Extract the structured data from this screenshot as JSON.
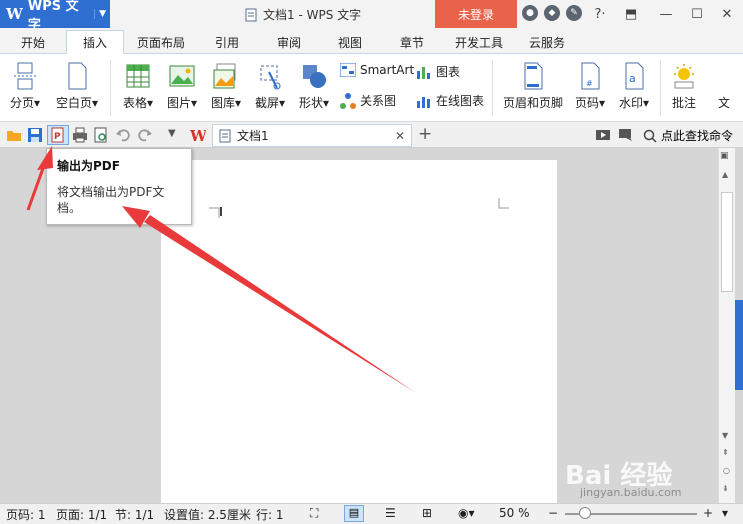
{
  "app": {
    "brand": "WPS 文字",
    "doc_title": "文档1 - WPS 文字",
    "login": "未登录"
  },
  "tabs": [
    "开始",
    "插入",
    "页面布局",
    "引用",
    "审阅",
    "视图",
    "章节",
    "开发工具",
    "云服务"
  ],
  "active_tab": "插入",
  "ribbon": {
    "page_break": "分页",
    "blank_page": "空白页",
    "table": "表格",
    "picture": "图片",
    "gallery": "图库",
    "screenshot": "截屏",
    "shape": "形状",
    "smartart": "SmartArt",
    "relation": "关系图",
    "chart": "图表",
    "online_chart": "在线图表",
    "header_footer": "页眉和页脚",
    "page_number": "页码",
    "watermark": "水印",
    "comment": "批注",
    "text": "文"
  },
  "doc_tab": {
    "name": "文档1"
  },
  "search_cmd": "点此查找命令",
  "tooltip": {
    "title": "输出为PDF",
    "desc": "将文档输出为PDF文档。"
  },
  "status": {
    "page_no": "页码: 1",
    "pages": "页面: 1/1",
    "section": "节: 1/1",
    "setting": "设置值: 2.5厘米",
    "line": "行: 1",
    "zoom": "50 %"
  },
  "watermark": {
    "brand": "Bai 经验",
    "url": "jingyan.baidu.com"
  },
  "colors": {
    "brand": "#2f6fd2",
    "login": "#e9624a",
    "arrow": "#e83a3a"
  }
}
